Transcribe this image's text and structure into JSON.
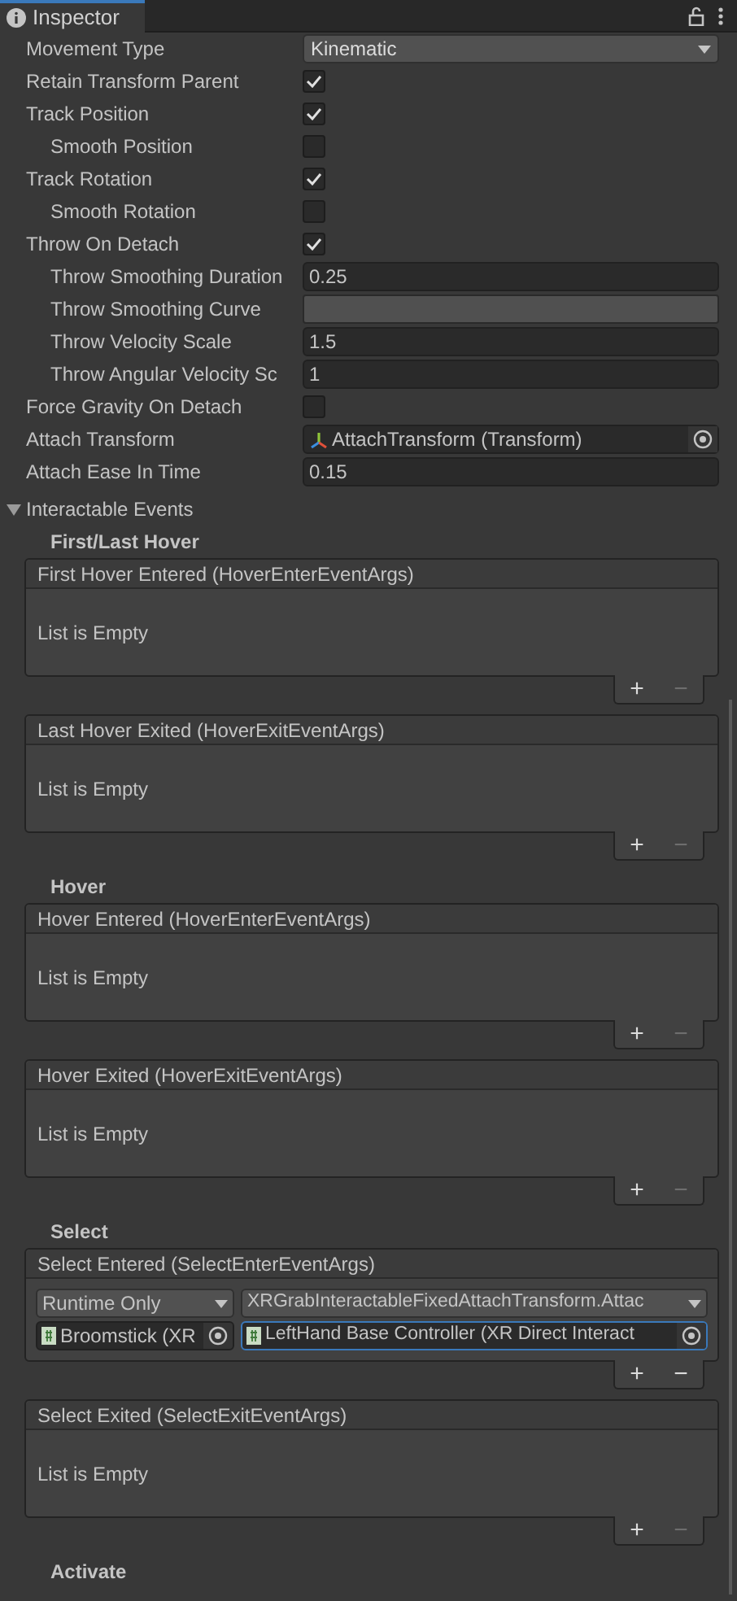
{
  "tab": {
    "title": "Inspector"
  },
  "fields": [
    {
      "kind": "dropdown",
      "label": "Movement Type",
      "value": "Kinematic"
    },
    {
      "kind": "checkbox",
      "label": "Retain Transform Parent",
      "checked": true
    },
    {
      "kind": "checkbox",
      "label": "Track Position",
      "checked": true,
      "children": [
        {
          "kind": "checkbox",
          "label": "Smooth Position",
          "checked": false
        }
      ]
    },
    {
      "kind": "checkbox",
      "label": "Track Rotation",
      "checked": true,
      "children": [
        {
          "kind": "checkbox",
          "label": "Smooth Rotation",
          "checked": false
        }
      ]
    },
    {
      "kind": "checkbox",
      "label": "Throw On Detach",
      "checked": true,
      "children": [
        {
          "kind": "number",
          "label": "Throw Smoothing Duration",
          "value": "0.25"
        },
        {
          "kind": "curve",
          "label": "Throw Smoothing Curve"
        },
        {
          "kind": "number",
          "label": "Throw Velocity Scale",
          "value": "1.5"
        },
        {
          "kind": "number",
          "label": "Throw Angular Velocity Sc",
          "value": "1"
        }
      ]
    },
    {
      "kind": "checkbox",
      "label": "Force Gravity On Detach",
      "checked": false
    },
    {
      "kind": "object",
      "label": "Attach Transform",
      "value": "AttachTransform (Transform)"
    },
    {
      "kind": "number",
      "label": "Attach Ease In Time",
      "value": "0.15"
    }
  ],
  "events_foldout": {
    "title": "Interactable Events",
    "expanded": true
  },
  "event_groups": [
    {
      "title": "First/Last Hover",
      "events": [
        {
          "title": "First Hover Entered (HoverEnterEventArgs)",
          "empty_text": "List is Empty",
          "add": "+",
          "remove": "−",
          "remove_disabled": true
        },
        {
          "title": "Last Hover Exited (HoverExitEventArgs)",
          "empty_text": "List is Empty",
          "add": "+",
          "remove": "−",
          "remove_disabled": true
        }
      ]
    },
    {
      "title": "Hover",
      "events": [
        {
          "title": "Hover Entered (HoverEnterEventArgs)",
          "empty_text": "List is Empty",
          "add": "+",
          "remove": "−",
          "remove_disabled": true
        },
        {
          "title": "Hover Exited (HoverExitEventArgs)",
          "empty_text": "List is Empty",
          "add": "+",
          "remove": "−",
          "remove_disabled": true
        }
      ]
    },
    {
      "title": "Select",
      "events": [
        {
          "title": "Select Entered (SelectEnterEventArgs)",
          "listeners": [
            {
              "runtime": "Runtime Only",
              "function": "XRGrabInteractableFixedAttachTransform.Attac",
              "target": "Broomstick (XR",
              "argument": "LeftHand Base Controller (XR Direct Interact",
              "focused": true
            }
          ],
          "add": "+",
          "remove": "−",
          "remove_disabled": false
        },
        {
          "title": "Select Exited (SelectExitEventArgs)",
          "empty_text": "List is Empty",
          "add": "+",
          "remove": "−",
          "remove_disabled": true
        }
      ]
    },
    {
      "title": "Activate"
    }
  ]
}
